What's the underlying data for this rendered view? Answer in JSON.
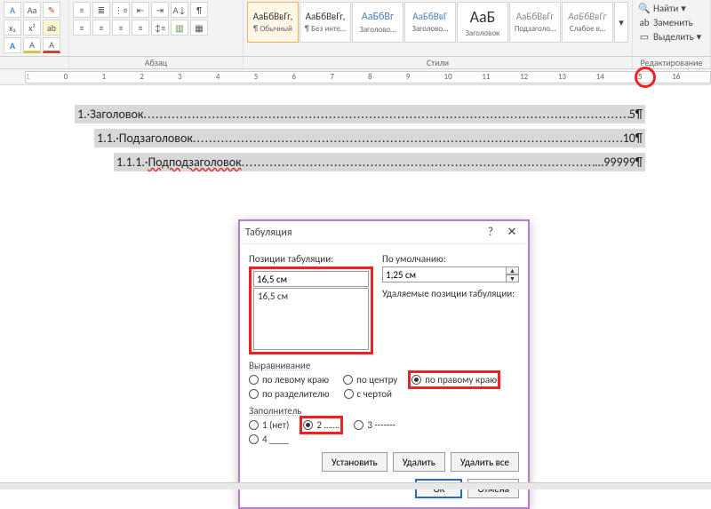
{
  "ribbon": {
    "paragraph_label": "Абзац",
    "styles_label": "Стили",
    "editing_label": "Редактирование",
    "styles": [
      {
        "sample": "АаБбВвГг,",
        "name": "¶ Обычный",
        "color": "#333",
        "bold": false,
        "italic": false,
        "size": 11
      },
      {
        "sample": "АаБбВвГг,",
        "name": "¶ Без инте…",
        "color": "#333",
        "bold": false,
        "italic": false,
        "size": 11
      },
      {
        "sample": "АаБбВг",
        "name": "Заголово…",
        "color": "#4a7ebb",
        "bold": false,
        "italic": false,
        "size": 12
      },
      {
        "sample": "АаБбВвГ",
        "name": "Заголово…",
        "color": "#4a7ebb",
        "bold": false,
        "italic": false,
        "size": 11
      },
      {
        "sample": "АаБ",
        "name": "Заголовок",
        "color": "#333",
        "bold": false,
        "italic": false,
        "size": 18
      },
      {
        "sample": "АаБбВвГг",
        "name": "Подзаголо…",
        "color": "#888",
        "bold": false,
        "italic": false,
        "size": 11
      },
      {
        "sample": "АаБбВвГг",
        "name": "Слабое в…",
        "color": "#888",
        "bold": false,
        "italic": true,
        "size": 11
      }
    ],
    "editing": {
      "find": "Найти",
      "replace": "Заменить",
      "select": "Выделить"
    }
  },
  "ruler": {
    "min": -1,
    "max": 17
  },
  "doc": {
    "lines": [
      {
        "num": "1.",
        "text": "Заголовок",
        "page": "5¶"
      },
      {
        "num": "1.1.",
        "text": "Подзаголовок",
        "page": "10¶"
      },
      {
        "num": "1.1.1.",
        "text": "Подподзаголовок",
        "page": "…99999¶"
      }
    ]
  },
  "dialog": {
    "title": "Табуляция",
    "positions_label": "Позиции табуляции:",
    "default_label": "По умолчанию:",
    "default_value": "1,25 см",
    "clear_label": "Удаляемые позиции табуляции:",
    "position_value": "16,5 см",
    "position_list": [
      "16,5 см"
    ],
    "align_label": "Выравнивание",
    "align_opts": {
      "left": "по левому краю",
      "center": "по центру",
      "right": "по правому краю",
      "decimal": "по разделителю",
      "bar": "с чертой"
    },
    "leader_label": "Заполнитель",
    "leader_opts": {
      "none": "1 (нет)",
      "dots": "2 …….",
      "dashes": "3 -------",
      "under": "4 ____"
    },
    "buttons": {
      "set": "Установить",
      "clear": "Удалить",
      "clear_all": "Удалить все",
      "ok": "OK",
      "cancel": "Отмена"
    }
  }
}
